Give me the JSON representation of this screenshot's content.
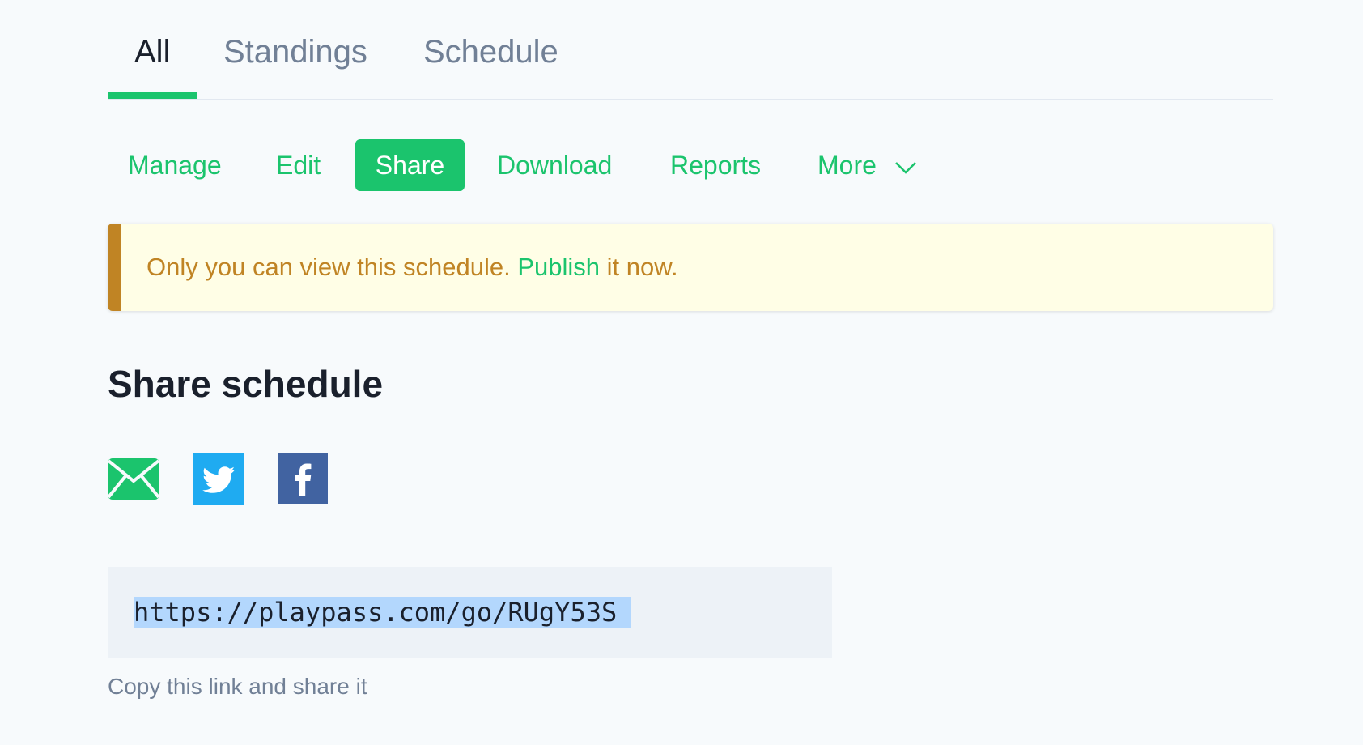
{
  "tabs": [
    {
      "label": "All",
      "active": true
    },
    {
      "label": "Standings",
      "active": false
    },
    {
      "label": "Schedule",
      "active": false
    }
  ],
  "actions": [
    {
      "label": "Manage",
      "active": false
    },
    {
      "label": "Edit",
      "active": false
    },
    {
      "label": "Share",
      "active": true
    },
    {
      "label": "Download",
      "active": false
    },
    {
      "label": "Reports",
      "active": false
    },
    {
      "label": "More",
      "active": false,
      "icon": "chevron-down-icon"
    }
  ],
  "banner": {
    "text": "Only you can view this schedule.",
    "link_label": "Publish",
    "suffix": "it now."
  },
  "share": {
    "heading": "Share schedule",
    "icons": [
      {
        "name": "email-icon",
        "color": "#1bc46d"
      },
      {
        "name": "twitter-icon",
        "color": "#1da1f2"
      },
      {
        "name": "facebook-icon",
        "color": "#3b5998"
      }
    ],
    "link": "https://playpass.com/go/RUgY53S",
    "caption": "Copy this link and share it"
  },
  "colors": {
    "accent": "#1bc46d",
    "warning": "#c08424",
    "warning_bg": "#fffee6",
    "text_dark": "#1a202c",
    "text_muted": "#718096",
    "selection": "#b3d7fd"
  }
}
